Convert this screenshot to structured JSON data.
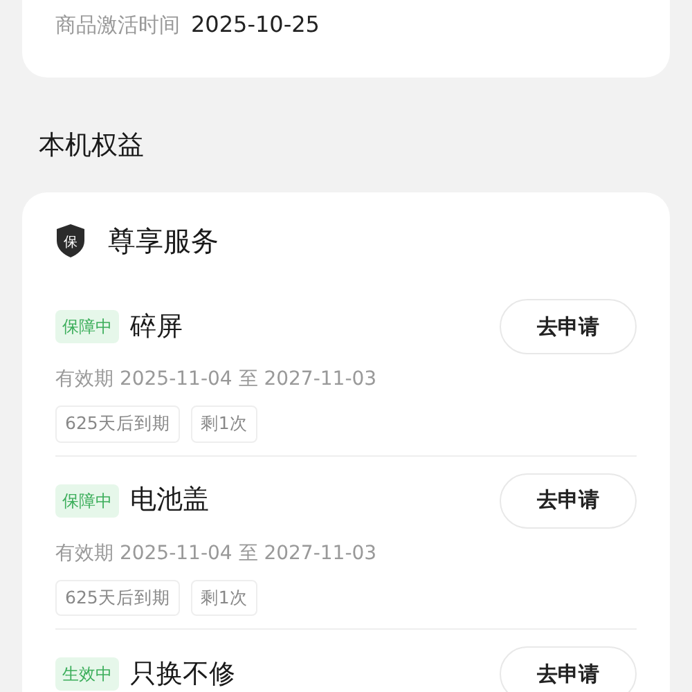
{
  "activation": {
    "label": "商品激活时间",
    "value": "2025-10-25"
  },
  "section_title": "本机权益",
  "service_card": {
    "title": "尊享服务",
    "icon_text": "保",
    "items": [
      {
        "status": "保障中",
        "name": "碎屏",
        "validity": "有效期 2025-11-04 至 2027-11-03",
        "tags": [
          "625天后到期",
          "剩1次"
        ],
        "button": "去申请"
      },
      {
        "status": "保障中",
        "name": "电池盖",
        "validity": "有效期 2025-11-04 至 2027-11-03",
        "tags": [
          "625天后到期",
          "剩1次"
        ],
        "button": "去申请"
      },
      {
        "status": "生效中",
        "name": "只换不修",
        "button": "去申请"
      }
    ]
  }
}
